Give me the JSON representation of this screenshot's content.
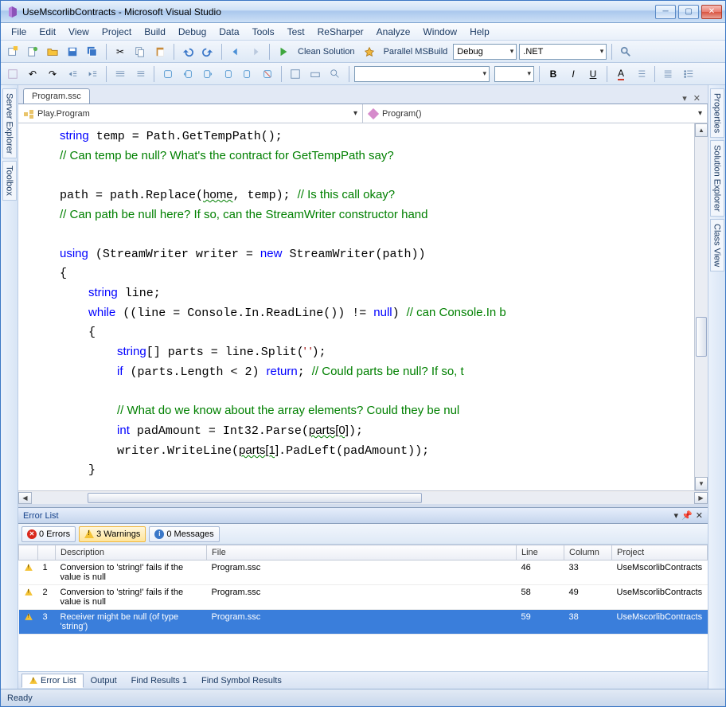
{
  "window": {
    "title": "UseMscorlibContracts - Microsoft Visual Studio"
  },
  "menu": [
    "File",
    "Edit",
    "View",
    "Project",
    "Build",
    "Debug",
    "Data",
    "Tools",
    "Test",
    "ReSharper",
    "Analyze",
    "Window",
    "Help"
  ],
  "toolbar1": {
    "clean": "Clean Solution",
    "parallel": "Parallel MSBuild",
    "config": "Debug",
    "platform": ".NET"
  },
  "toolbar2": {
    "fontcombo": "",
    "sizecombo": ""
  },
  "side_left": [
    "Server Explorer",
    "Toolbox"
  ],
  "side_right": [
    "Properties",
    "Solution Explorer",
    "Class View"
  ],
  "doc": {
    "tab": "Program.ssc",
    "nav_left": "Play.Program",
    "nav_right": "Program()"
  },
  "errorlist": {
    "title": "Error List",
    "filters": {
      "errors": "0 Errors",
      "warnings": "3 Warnings",
      "messages": "0 Messages"
    },
    "columns": [
      "",
      "",
      "Description",
      "File",
      "Line",
      "Column",
      "Project"
    ],
    "rows": [
      {
        "n": "1",
        "desc": "Conversion to 'string!' fails if the value is null",
        "file": "Program.ssc",
        "line": "46",
        "col": "33",
        "proj": "UseMscorlibContracts",
        "sel": false
      },
      {
        "n": "2",
        "desc": "Conversion to 'string!' fails if the value is null",
        "file": "Program.ssc",
        "line": "58",
        "col": "49",
        "proj": "UseMscorlibContracts",
        "sel": false
      },
      {
        "n": "3",
        "desc": "Receiver might be null (of type 'string')",
        "file": "Program.ssc",
        "line": "59",
        "col": "38",
        "proj": "UseMscorlibContracts",
        "sel": true
      }
    ]
  },
  "bottomtabs": [
    "Error List",
    "Output",
    "Find Results 1",
    "Find Symbol Results"
  ],
  "status": "Ready"
}
